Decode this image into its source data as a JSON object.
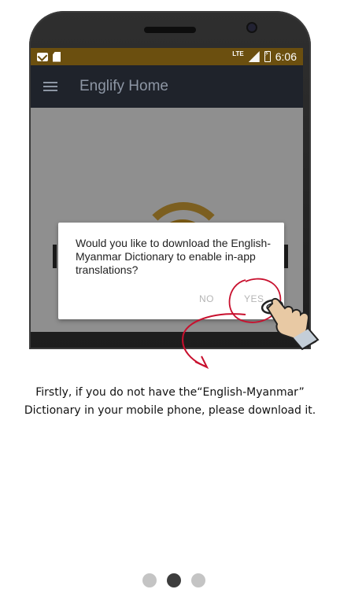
{
  "status_bar": {
    "left_icons": [
      "gmail-icon",
      "sd-card-icon"
    ],
    "network": "LTE",
    "time": "6:06"
  },
  "app_bar": {
    "menu_icon": "hamburger-menu-icon",
    "title": "Englify Home"
  },
  "dialog": {
    "message": "Would you like to download the English-Myanmar Dictionary to enable in-app translations?",
    "no_label": "NO",
    "yes_label": "YES"
  },
  "caption": {
    "line1": "Firstly, if you do not have the“English-Myanmar”",
    "line2": "Dictionary in your mobile phone, please download it."
  },
  "pagination": {
    "total": 3,
    "active_index": 1
  },
  "colors": {
    "status_bar": "#6b4f0f",
    "app_bar": "#1f232b",
    "annotation_red": "#c8102e",
    "dot_active": "#3d3d3d",
    "dot_inactive": "#c4c4c4"
  }
}
